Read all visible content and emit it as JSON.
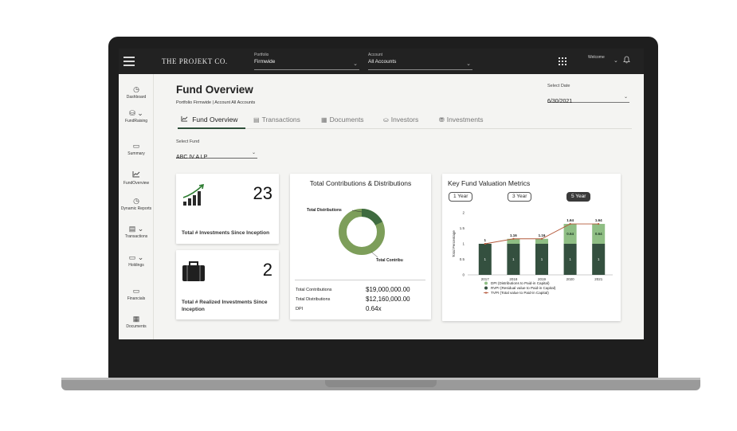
{
  "topbar": {
    "brand": "THE PROJEKT CO.",
    "portfolio": {
      "label": "Portfolio",
      "value": "Firmwide"
    },
    "account": {
      "label": "Account",
      "value": "All Accounts"
    },
    "welcome": "Welcome"
  },
  "sidebar": {
    "items": [
      {
        "label": "Dashboard",
        "icon": "gauge-icon"
      },
      {
        "label": "FundRaising",
        "icon": "coins-icon"
      },
      {
        "label": "Summary",
        "icon": "summary-icon"
      },
      {
        "label": "FundOverview",
        "icon": "trend-chart-icon"
      },
      {
        "label": "Dynamic Reports",
        "icon": "gauge-icon"
      },
      {
        "label": "Transactions",
        "icon": "transactions-icon"
      },
      {
        "label": "Holdings",
        "icon": "holdings-icon"
      },
      {
        "label": "Financials",
        "icon": "financials-icon"
      },
      {
        "label": "Documents",
        "icon": "documents-icon"
      }
    ]
  },
  "page": {
    "title": "Fund Overview",
    "subtitle": "Portfolio Firmwide | Account All Accounts",
    "date_label": "Select Date",
    "date_value": "6/30/2021",
    "fund_label": "Select Fund",
    "fund_value": "ABC IV A LP"
  },
  "tabs": [
    {
      "label": "Fund Overview",
      "icon": "trend-chart-icon",
      "active": true
    },
    {
      "label": "Transactions",
      "icon": "transactions-icon"
    },
    {
      "label": "Documents",
      "icon": "documents-icon"
    },
    {
      "label": "Investors",
      "icon": "investors-icon"
    },
    {
      "label": "Investments",
      "icon": "investments-icon"
    }
  ],
  "kpis": [
    {
      "value": "23",
      "label": "Total # Investments Since Inception",
      "icon": "bar-growth-icon"
    },
    {
      "value": "2",
      "label": "Total # Realized Investments Since Inception",
      "icon": "briefcase-icon"
    }
  ],
  "contributions": {
    "title": "Total Contributions & Distributions",
    "donut_labels": {
      "distributions": "Total Distributions",
      "contributions": "Total Contribu"
    },
    "rows": [
      {
        "label": "Total Contributions",
        "value": "$19,000,000.00"
      },
      {
        "label": "Total Distributions",
        "value": "$12,160,000.00"
      },
      {
        "label": "DPI",
        "value": "0.64x"
      }
    ],
    "colors": {
      "distributions": "#3f6b40",
      "contributions": "#7d9e5a"
    }
  },
  "valuation": {
    "title": "Key Fund Valuation Metrics",
    "buttons": [
      {
        "label": "1 Year",
        "active": false
      },
      {
        "label": "3 Year",
        "active": false
      },
      {
        "label": "5 Year",
        "active": true
      }
    ]
  },
  "chart_data": {
    "type": "bar",
    "title": "Key Fund Valuation Metrics",
    "categories": [
      "2017",
      "2018",
      "2019",
      "2020",
      "2021"
    ],
    "ylabel": "Total Percentage",
    "ylim": [
      0,
      2
    ],
    "yticks": [
      0,
      0.5,
      1,
      1.5,
      2
    ],
    "ytick_labels": [
      "0",
      "0.5",
      "1",
      "1.5",
      "2"
    ],
    "stacked": true,
    "series": [
      {
        "name": "RVPI (Residual value to Paid-in Capital)",
        "values": [
          1,
          1,
          1,
          1,
          1
        ],
        "labels": [
          "1",
          "1",
          "1",
          "1",
          "1"
        ],
        "color": "#34503f"
      },
      {
        "name": "DPI (Distributions to Paid-in Capital)",
        "values": [
          0,
          0.16,
          0.16,
          0.64,
          0.64
        ],
        "labels": [
          "",
          "",
          "",
          "0.64",
          "0.64"
        ],
        "color": "#8fbe84"
      },
      {
        "name": "TVPI (Total value to Paid-in Capital)",
        "type": "line",
        "values": [
          1,
          1.16,
          1.16,
          1.64,
          1.64
        ],
        "labels": [
          "1",
          "1.16",
          "1.16",
          "1.64",
          "1.64"
        ],
        "color": "#b4583a"
      }
    ],
    "legend": "bottom",
    "grid": false
  }
}
